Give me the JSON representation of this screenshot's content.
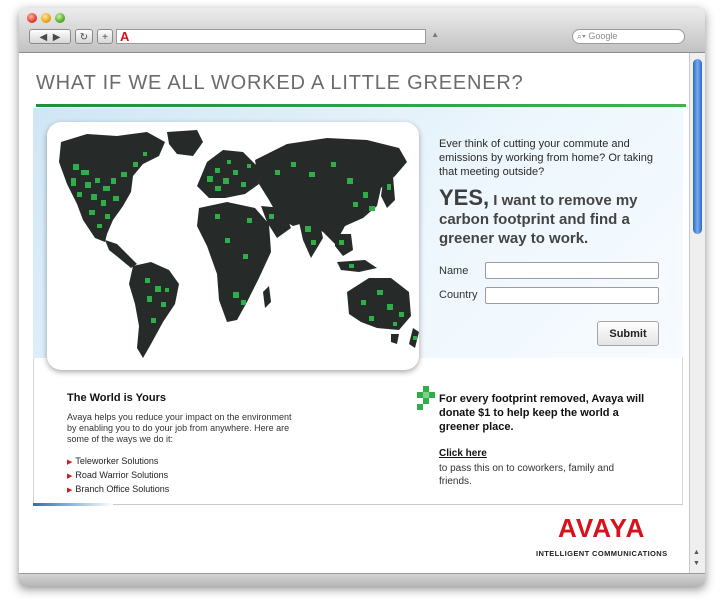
{
  "browser": {
    "address_icon": "A",
    "search_placeholder": "Google",
    "icons": {
      "back": "back-arrow-icon",
      "forward": "forward-arrow-icon",
      "reload": "reload-icon",
      "add": "plus-icon",
      "search": "magnifier-icon"
    }
  },
  "page": {
    "headline": "WHAT IF WE ALL WORKED A LITTLE GREENER?",
    "intro_question": "Ever think of cutting your commute and emissions by working from home? Or taking that meeting outside?",
    "yes_lead": "YES,",
    "yes_rest": " I want to remove my carbon footprint and find a greener way to work.",
    "form": {
      "name_label": "Name",
      "country_label": "Country",
      "name_value": "",
      "country_value": "",
      "submit_label": "Submit"
    },
    "world_title": "The World is Yours",
    "world_desc": "Avaya helps you reduce your impact on the environment by enabling you to do your job from anywhere. Here are some of the ways we do it:",
    "solutions": [
      "Teleworker Solutions",
      "Road Warrior Solutions",
      "Branch Office Solutions"
    ],
    "donate": "For every footprint removed, Avaya will donate $1 to help keep the world a greener place.",
    "click_here": "Click here",
    "share_text": "to pass this on to coworkers, family and friends.",
    "logo": {
      "word": "AVAYA",
      "tagline": "INTELLIGENT COMMUNICATIONS"
    }
  },
  "colors": {
    "accent_green": "#2fae4a",
    "land_dark": "#262a29",
    "brand_red": "#d8121d"
  }
}
